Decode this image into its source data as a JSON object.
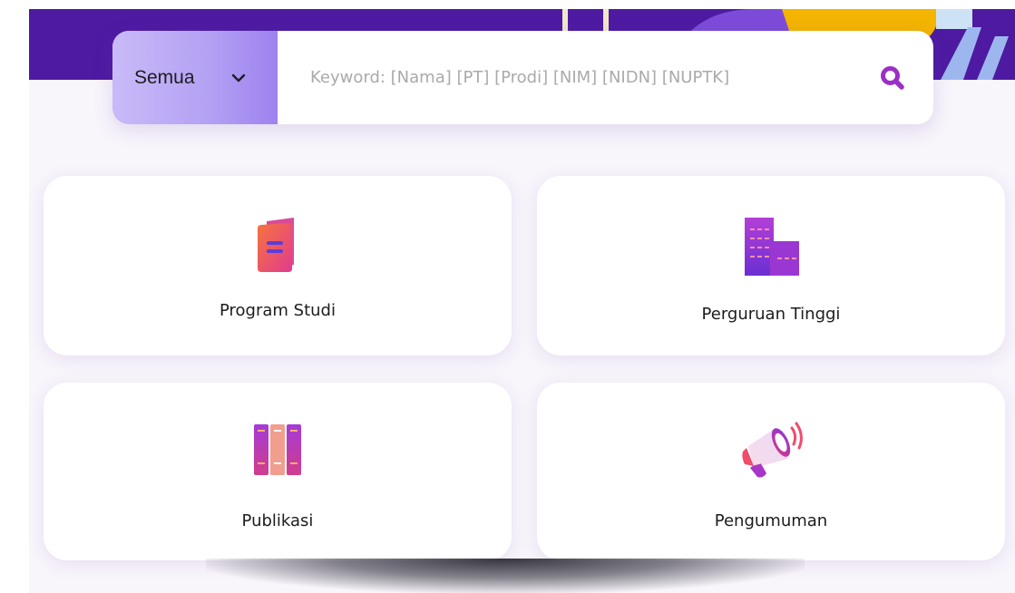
{
  "search": {
    "category_selected": "Semua",
    "placeholder": "Keyword: [Nama] [PT] [Prodi] [NIM] [NIDN] [NUPTK]",
    "value": ""
  },
  "cards": {
    "program_studi": {
      "label": "Program Studi",
      "icon": "book-icon"
    },
    "perguruan_tinggi": {
      "label": "Perguruan Tinggi",
      "icon": "buildings-icon"
    },
    "publikasi": {
      "label": "Publikasi",
      "icon": "binders-icon"
    },
    "pengumuman": {
      "label": "Pengumuman",
      "icon": "megaphone-icon"
    }
  },
  "colors": {
    "hero": "#4d1aa1",
    "accent": "#9b2fc6",
    "select_gradient_start": "#c9baf8",
    "select_gradient_end": "#9c82ef",
    "page_background": "#f8f5fb"
  }
}
